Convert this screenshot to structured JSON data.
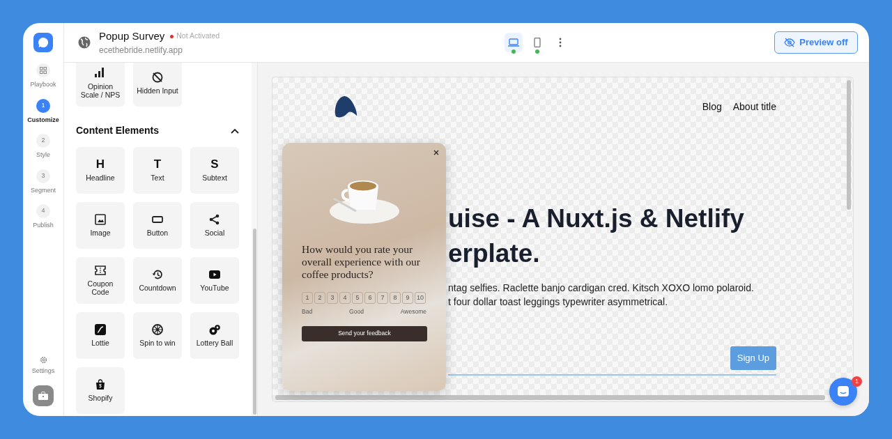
{
  "rail": {
    "items": [
      {
        "kind": "icon",
        "label": "Playbook",
        "selected": false
      },
      {
        "kind": "step",
        "number": "1",
        "label": "Customize",
        "selected": true
      },
      {
        "kind": "step",
        "number": "2",
        "label": "Style",
        "selected": false
      },
      {
        "kind": "step",
        "number": "3",
        "label": "Segment",
        "selected": false
      },
      {
        "kind": "step",
        "number": "4",
        "label": "Publish",
        "selected": false
      }
    ],
    "settings": "Settings"
  },
  "header": {
    "title": "Popup Survey",
    "activated": false,
    "status": "Not Activated",
    "domain": "ecethebride.netlify.app",
    "devices": [
      {
        "kind": "desktop",
        "selected": true
      },
      {
        "kind": "mobile",
        "selected": false
      }
    ],
    "preview_button": "Preview off"
  },
  "panel": {
    "partial_items": [
      {
        "kind": "bars",
        "label": "Opinion Scale / NPS"
      },
      {
        "kind": "hidden",
        "label": "Hidden Input"
      }
    ],
    "section": {
      "title": "Content Elements",
      "expanded": true,
      "items": [
        {
          "kind": "letter",
          "glyph": "H",
          "label": "Headline"
        },
        {
          "kind": "letter",
          "glyph": "T",
          "label": "Text"
        },
        {
          "kind": "letter",
          "glyph": "S",
          "label": "Subtext"
        },
        {
          "kind": "image",
          "label": "Image"
        },
        {
          "kind": "button",
          "label": "Button"
        },
        {
          "kind": "share",
          "label": "Social"
        },
        {
          "kind": "coupon",
          "label": "Coupon Code"
        },
        {
          "kind": "history",
          "label": "Countdown"
        },
        {
          "kind": "youtube",
          "label": "YouTube"
        },
        {
          "kind": "lottie",
          "label": "Lottie"
        },
        {
          "kind": "wheel",
          "label": "Spin to win"
        },
        {
          "kind": "ball",
          "label": "Lottery Ball"
        },
        {
          "kind": "bag",
          "label": "Shopify"
        }
      ]
    }
  },
  "preview": {
    "nav": [
      "Blog",
      "About title"
    ],
    "hero_lines": [
      "uise - A Nuxt.js & Netlify",
      "erplate."
    ],
    "body_lines": [
      "ntag selfies. Raclette banjo cardigan cred. Kitsch XOXO lomo polaroid.",
      "t four dollar toast leggings typewriter asymmetrical."
    ],
    "signup": "Sign Up",
    "popup": {
      "question": "How would you rate your overall experience with our coffee products?",
      "scale": [
        "1",
        "2",
        "3",
        "4",
        "5",
        "6",
        "7",
        "8",
        "9",
        "10"
      ],
      "scale_labels": [
        "Bad",
        "Good",
        "Awesome"
      ],
      "submit": "Send your feedback"
    }
  },
  "chat_badge": "1"
}
